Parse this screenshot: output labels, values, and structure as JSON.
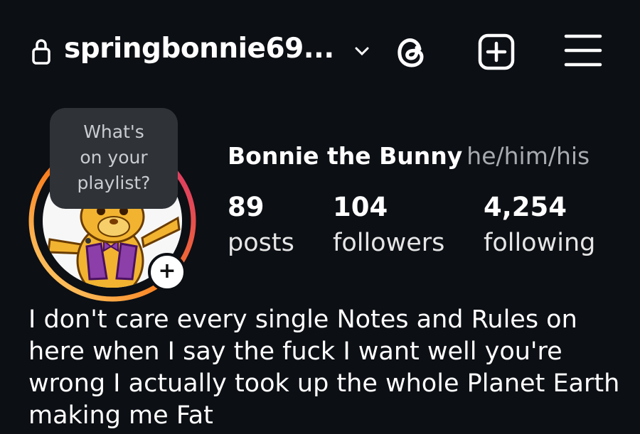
{
  "header": {
    "username": "springbonnie69...",
    "icons": [
      "lock-icon",
      "chevron-down-icon",
      "threads-icon",
      "create-post-icon",
      "menu-icon"
    ]
  },
  "note": {
    "line1": "What's",
    "line2": "on your",
    "line3": "playlist?"
  },
  "profile": {
    "name": "Bonnie the Bunny",
    "pronouns": "he/him/his",
    "stats": [
      {
        "value": "89",
        "label": "posts"
      },
      {
        "value": "104",
        "label": "followers"
      },
      {
        "value": "4,254",
        "label": "following"
      }
    ],
    "bio": "I don't care every single Notes and Rules on here when I say the fuck I want well you're wrong I actually took up the whole Planet Earth making me Fat",
    "add_story_symbol": "+"
  },
  "colors": {
    "background": "#0c0f14",
    "ring_start": "#feda75",
    "ring_mid": "#fa7e1e",
    "ring_end": "#d62976"
  }
}
